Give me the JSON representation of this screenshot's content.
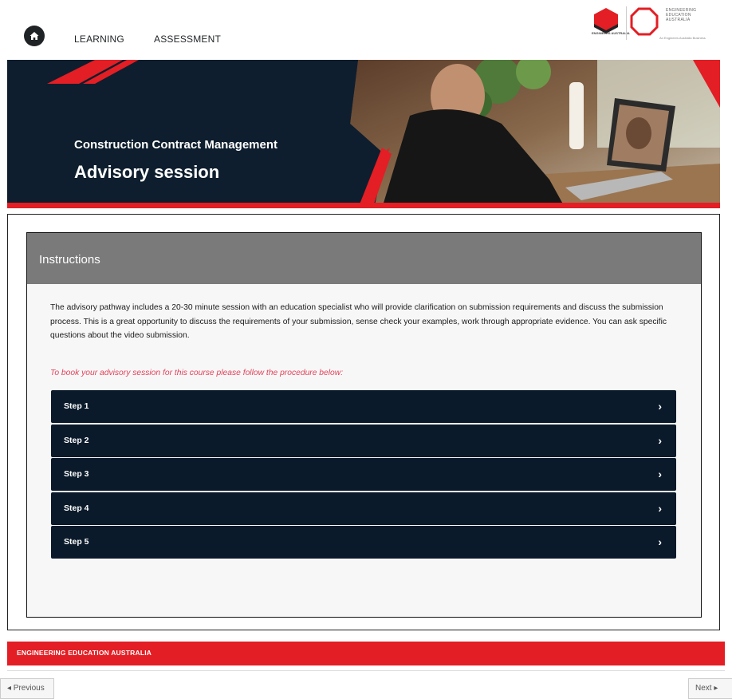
{
  "nav": {
    "learning": "LEARNING",
    "assessment": "ASSESSMENT"
  },
  "logos": {
    "ea_label": "ENGINEERS AUSTRALIA",
    "eea_line1": "ENGINEERING",
    "eea_line2": "EDUCATION",
    "eea_line3": "AUSTRALIA",
    "eea_tagline": "An Engineers Australia Business"
  },
  "banner": {
    "subtitle": "Construction Contract Management",
    "title": "Advisory session"
  },
  "instructions": {
    "heading": "Instructions",
    "body": "The advisory pathway includes a 20-30 minute session with an education specialist who will provide clarification on submission requirements and discuss the submission process. This is a great opportunity to discuss the requirements of your submission, sense check your examples, work through appropriate evidence. You can ask specific questions about the video submission.",
    "note": "To book your advisory session for this course please follow the procedure below:"
  },
  "steps": [
    {
      "label": "Step 1"
    },
    {
      "label": "Step 2"
    },
    {
      "label": "Step 3"
    },
    {
      "label": "Step 4"
    },
    {
      "label": "Step 5"
    }
  ],
  "footer": {
    "org": "ENGINEERING EDUCATION AUSTRALIA"
  },
  "pager": {
    "previous": "◂ Previous",
    "next": "Next ▸"
  },
  "colors": {
    "brand_red": "#e31e24",
    "navy": "#0b1a2b",
    "note_pink": "#e0425a",
    "header_gray": "#7a7a7a"
  },
  "icons": {
    "home": "home-icon",
    "chevron": "chevron-right-icon"
  }
}
